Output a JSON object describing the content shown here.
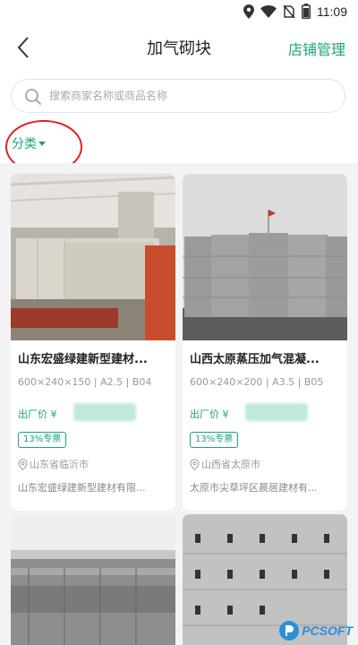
{
  "status_bar": {
    "time": "11:09"
  },
  "header": {
    "title": "加气砌块",
    "action_label": "店铺管理"
  },
  "search": {
    "placeholder": "搜索商家名称或商品名称"
  },
  "filter": {
    "category_label": "分类"
  },
  "products": [
    {
      "name": "山东宏盛绿建新型建材...",
      "spec": "600×240×150 | A2.5 | B04",
      "price_label": "出厂价 ¥",
      "tag": "13%专票",
      "location": "山东省临沂市",
      "company": "山东宏盛绿建新型建材有限..."
    },
    {
      "name": "山西太原蒸压加气混凝...",
      "spec": "600×240×200 | A3.5 | B05",
      "price_label": "出厂价 ¥",
      "tag": "13%专票",
      "location": "山西省太原市",
      "company": "太原市尖草坪区晨居建材有..."
    }
  ],
  "watermark": {
    "text": "PCSOFT"
  },
  "colors": {
    "accent": "#1aa37a",
    "annotation": "#e02020"
  }
}
